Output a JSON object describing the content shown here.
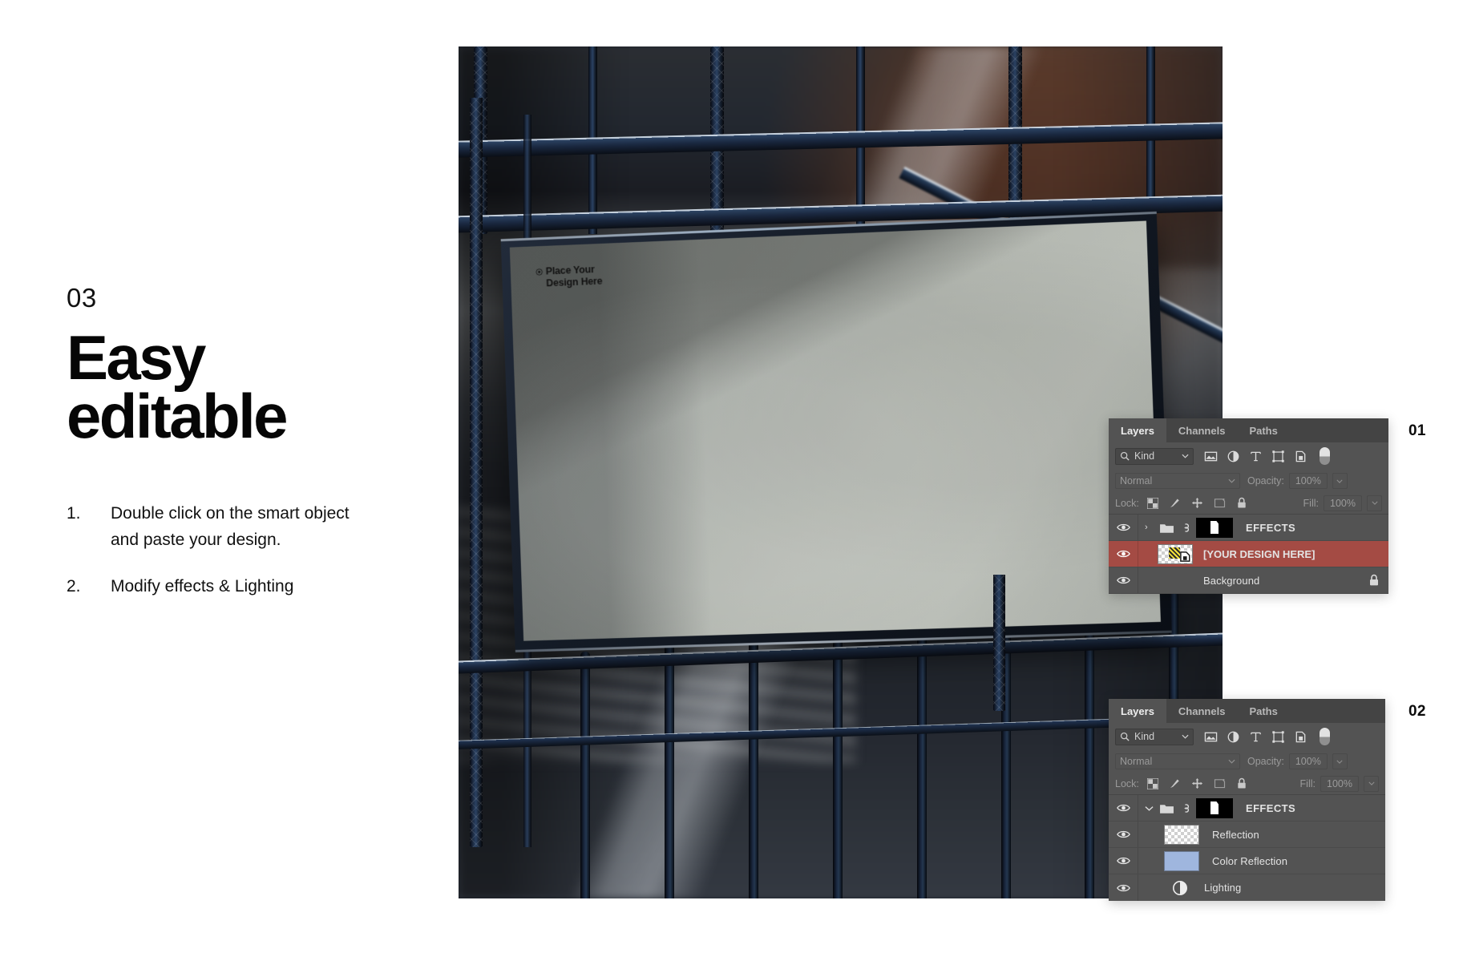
{
  "slide": {
    "step_number": "03",
    "headline_line1": "Easy",
    "headline_line2": "editable",
    "instructions": [
      {
        "num": "1.",
        "text": "Double click on the smart object and paste your design."
      },
      {
        "num": "2.",
        "text": "Modify effects & Lighting"
      }
    ]
  },
  "mockup": {
    "placeholder_label": "Place Your\nDesign Here",
    "target_icon": "target-icon"
  },
  "panels": [
    {
      "index_label": "01",
      "tabs": [
        {
          "label": "Layers",
          "active": true
        },
        {
          "label": "Channels",
          "active": false
        },
        {
          "label": "Paths",
          "active": false
        }
      ],
      "filter": {
        "kind_label": "Kind",
        "search_icon": "search-icon",
        "chevron_icon": "chevron-down-icon",
        "icons": [
          "image-filter-icon",
          "adjustment-filter-icon",
          "type-filter-icon",
          "shape-filter-icon",
          "smart-object-filter-icon"
        ],
        "toggle_icon": "filter-toggle-switch"
      },
      "blend": {
        "mode": "Normal",
        "opacity_label": "Opacity:",
        "opacity_value": "100%"
      },
      "lock": {
        "label": "Lock:",
        "icons": [
          "lock-transparent-pixels-icon",
          "lock-image-pixels-icon",
          "lock-position-icon",
          "lock-artboard-icon",
          "lock-all-icon"
        ],
        "fill_label": "Fill:",
        "fill_value": "100%"
      },
      "layers": [
        {
          "name": "EFFECTS",
          "type": "group",
          "expanded": false,
          "visible": true,
          "selected": false,
          "thumb": "mask",
          "locked": false
        },
        {
          "name": "[YOUR DESIGN HERE]",
          "type": "smart-object",
          "visible": true,
          "selected": true,
          "thumb": "checker-design",
          "locked": false
        },
        {
          "name": "Background",
          "type": "image",
          "visible": true,
          "selected": false,
          "thumb": "photo",
          "locked": true
        }
      ]
    },
    {
      "index_label": "02",
      "tabs": [
        {
          "label": "Layers",
          "active": true
        },
        {
          "label": "Channels",
          "active": false
        },
        {
          "label": "Paths",
          "active": false
        }
      ],
      "filter": {
        "kind_label": "Kind",
        "search_icon": "search-icon",
        "chevron_icon": "chevron-down-icon",
        "icons": [
          "image-filter-icon",
          "adjustment-filter-icon",
          "type-filter-icon",
          "shape-filter-icon",
          "smart-object-filter-icon"
        ],
        "toggle_icon": "filter-toggle-switch"
      },
      "blend": {
        "mode": "Normal",
        "opacity_label": "Opacity:",
        "opacity_value": "100%"
      },
      "lock": {
        "label": "Lock:",
        "icons": [
          "lock-transparent-pixels-icon",
          "lock-image-pixels-icon",
          "lock-position-icon",
          "lock-artboard-icon",
          "lock-all-icon"
        ],
        "fill_label": "Fill:",
        "fill_value": "100%"
      },
      "layers": [
        {
          "name": "EFFECTS",
          "type": "group",
          "expanded": true,
          "visible": true,
          "selected": false,
          "thumb": "mask",
          "locked": false
        },
        {
          "name": "Reflection",
          "type": "pixel",
          "visible": true,
          "selected": false,
          "thumb": "checker",
          "locked": false
        },
        {
          "name": "Color Reflection",
          "type": "fill",
          "visible": true,
          "selected": false,
          "thumb": "bluefill",
          "locked": false
        },
        {
          "name": "Lighting",
          "type": "adjustment",
          "visible": true,
          "selected": false,
          "thumb": "adjustment",
          "locked": false
        }
      ]
    }
  ],
  "colors": {
    "panel_bg": "#535353",
    "panel_tabbar": "#444444",
    "selected_row": "#a44b44",
    "text_primary": "#e3e3e3",
    "text_dim": "#9a9a9a",
    "page_bg": "#ffffff",
    "rail_blue": "#2b4263",
    "billboard_face": "#b4b8b1",
    "color_reflection_swatch": "#9fb6de"
  }
}
